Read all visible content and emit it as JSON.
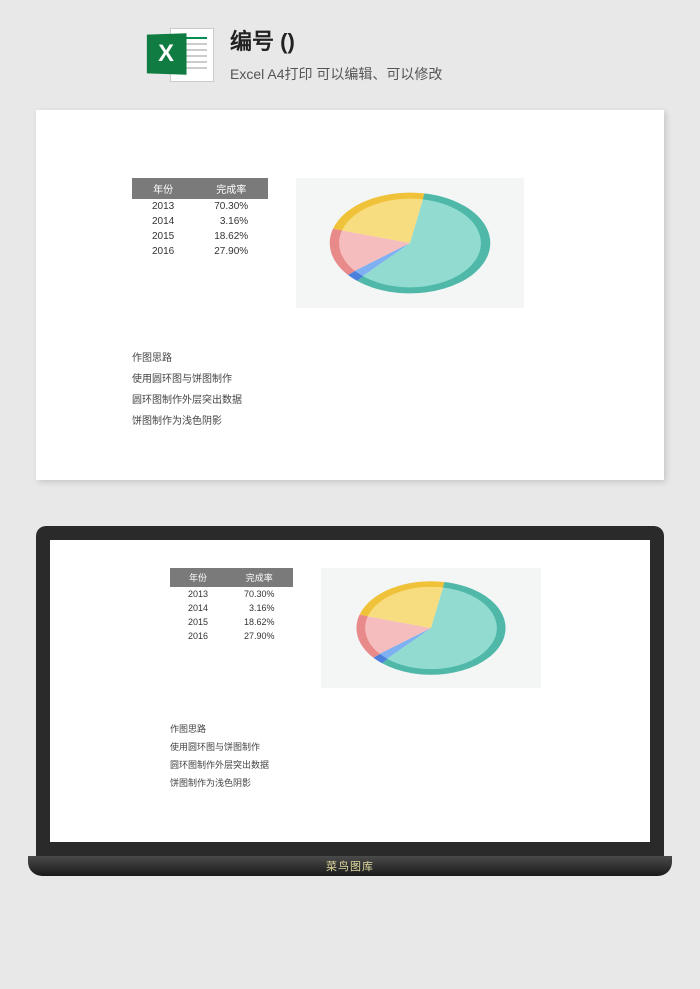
{
  "header": {
    "title": "编号 ()",
    "subtitle": "Excel A4打印 可以编辑、可以修改"
  },
  "table": {
    "headers": {
      "col1": "年份",
      "col2": "完成率"
    },
    "rows": [
      {
        "year": "2013",
        "rate": "70.30%"
      },
      {
        "year": "2014",
        "rate": "3.16%"
      },
      {
        "year": "2015",
        "rate": "18.62%"
      },
      {
        "year": "2016",
        "rate": "27.90%"
      }
    ]
  },
  "notes": {
    "line1": "作图思路",
    "line2": "使用圆环图与饼图制作",
    "line3": "圆环图制作外层突出数据",
    "line4": "饼图制作为浅色阴影"
  },
  "laptop_label": "菜鸟图库",
  "chart_data": {
    "type": "pie",
    "title": "",
    "categories": [
      "2013",
      "2014",
      "2015",
      "2016"
    ],
    "values": [
      70.3,
      3.16,
      18.62,
      27.9
    ],
    "colors": [
      "#7fd6c9",
      "#6aa3f0",
      "#f5b3b3",
      "#f8d86b"
    ],
    "ring_colors": [
      "#4fb8a8",
      "#4a7fdc",
      "#e88a8a",
      "#f0c23a"
    ]
  }
}
